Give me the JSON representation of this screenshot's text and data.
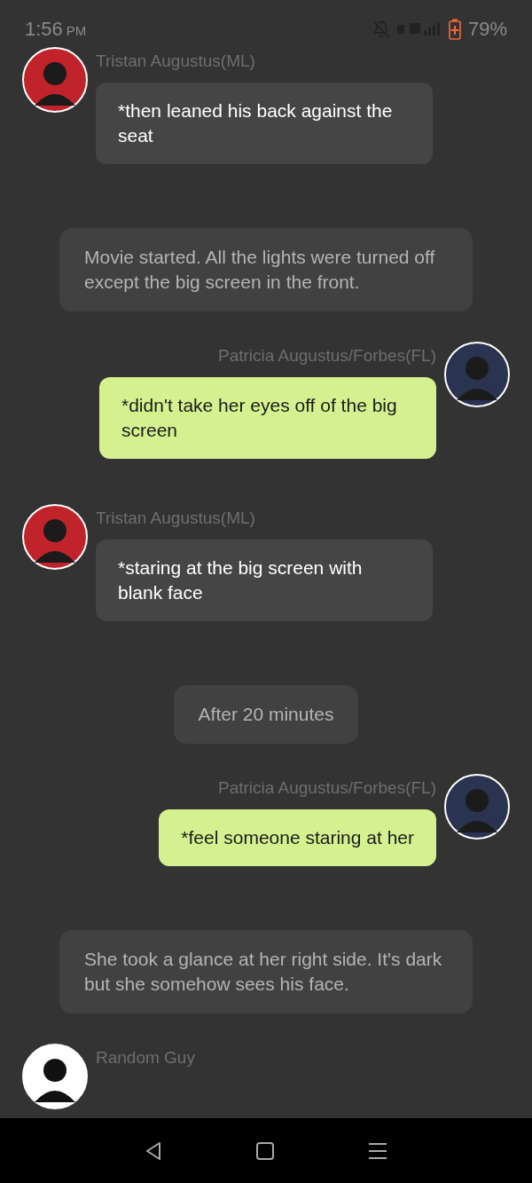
{
  "status_bar": {
    "time": "1:56",
    "meridiem": "PM",
    "battery": "79%",
    "charging": true
  },
  "messages": [
    {
      "kind": "message",
      "outgoing": false,
      "sender": "Tristan Augustus(ML)",
      "color": "#c0242a",
      "text": "*then leaned his back against the seat"
    },
    {
      "kind": "narration",
      "text": "Movie started. All the lights were turned off except the big screen in the front."
    },
    {
      "kind": "message",
      "outgoing": true,
      "sender": "Patricia Augustus/Forbes(FL)",
      "color": "#2a3350",
      "text": "*didn't take her eyes off of the big screen"
    },
    {
      "kind": "message",
      "outgoing": false,
      "sender": "Tristan Augustus(ML)",
      "color": "#c0242a",
      "text": "*staring at the big screen with blank face"
    },
    {
      "kind": "narration",
      "text": "After 20 minutes"
    },
    {
      "kind": "message",
      "outgoing": true,
      "sender": "Patricia Augustus/Forbes(FL)",
      "color": "#2a3350",
      "text": "*feel someone staring at her"
    },
    {
      "kind": "narration",
      "text": "She took a glance at her right side. It's dark but she somehow sees his face."
    },
    {
      "kind": "partial",
      "outgoing": false,
      "sender": "Random Guy",
      "color": "#ffffff"
    }
  ]
}
